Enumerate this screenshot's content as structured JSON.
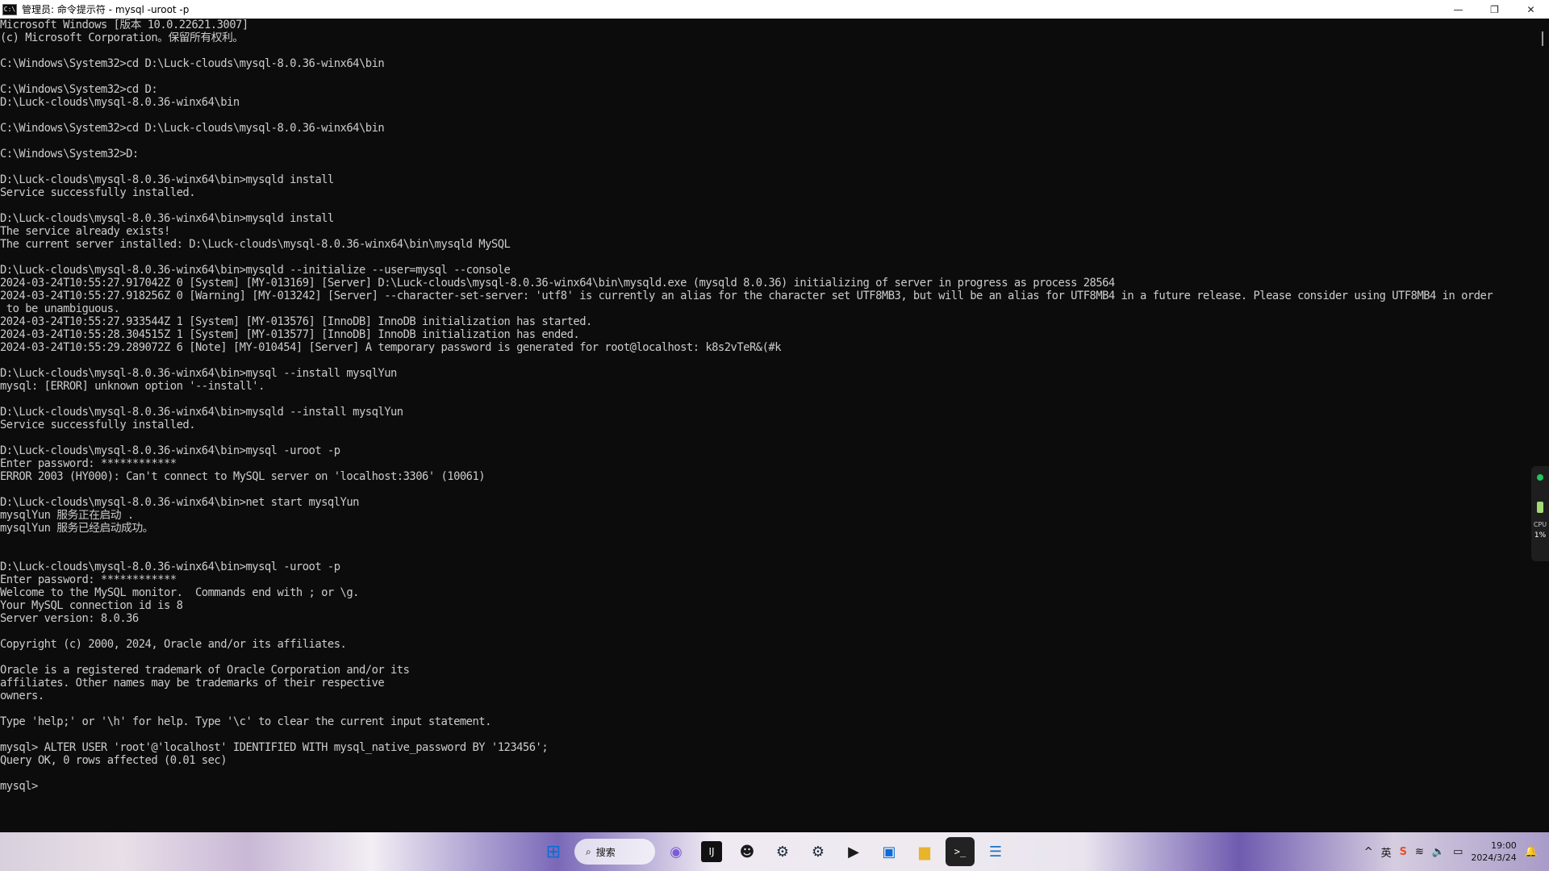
{
  "window": {
    "title": "管理员: 命令提示符 - mysql  -uroot -p",
    "icon_text": "C:\\",
    "controls": [
      "—",
      "❐",
      "✕"
    ]
  },
  "console": {
    "lines": [
      "Microsoft Windows [版本 10.0.22621.3007]",
      "(c) Microsoft Corporation。保留所有权利。",
      "",
      "C:\\Windows\\System32>cd D:\\Luck-clouds\\mysql-8.0.36-winx64\\bin",
      "",
      "C:\\Windows\\System32>cd D:",
      "D:\\Luck-clouds\\mysql-8.0.36-winx64\\bin",
      "",
      "C:\\Windows\\System32>cd D:\\Luck-clouds\\mysql-8.0.36-winx64\\bin",
      "",
      "C:\\Windows\\System32>D:",
      "",
      "D:\\Luck-clouds\\mysql-8.0.36-winx64\\bin>mysqld install",
      "Service successfully installed.",
      "",
      "D:\\Luck-clouds\\mysql-8.0.36-winx64\\bin>mysqld install",
      "The service already exists!",
      "The current server installed: D:\\Luck-clouds\\mysql-8.0.36-winx64\\bin\\mysqld MySQL",
      "",
      "D:\\Luck-clouds\\mysql-8.0.36-winx64\\bin>mysqld --initialize --user=mysql --console",
      "2024-03-24T10:55:27.917042Z 0 [System] [MY-013169] [Server] D:\\Luck-clouds\\mysql-8.0.36-winx64\\bin\\mysqld.exe (mysqld 8.0.36) initializing of server in progress as process 28564",
      "2024-03-24T10:55:27.918256Z 0 [Warning] [MY-013242] [Server] --character-set-server: 'utf8' is currently an alias for the character set UTF8MB3, but will be an alias for UTF8MB4 in a future release. Please consider using UTF8MB4 in order",
      " to be unambiguous.",
      "2024-03-24T10:55:27.933544Z 1 [System] [MY-013576] [InnoDB] InnoDB initialization has started.",
      "2024-03-24T10:55:28.304515Z 1 [System] [MY-013577] [InnoDB] InnoDB initialization has ended.",
      "2024-03-24T10:55:29.289072Z 6 [Note] [MY-010454] [Server] A temporary password is generated for root@localhost: k8s2vTeR&(#k",
      "",
      "D:\\Luck-clouds\\mysql-8.0.36-winx64\\bin>mysql --install mysqlYun",
      "mysql: [ERROR] unknown option '--install'.",
      "",
      "D:\\Luck-clouds\\mysql-8.0.36-winx64\\bin>mysqld --install mysqlYun",
      "Service successfully installed.",
      "",
      "D:\\Luck-clouds\\mysql-8.0.36-winx64\\bin>mysql -uroot -p",
      "Enter password: ************",
      "ERROR 2003 (HY000): Can't connect to MySQL server on 'localhost:3306' (10061)",
      "",
      "D:\\Luck-clouds\\mysql-8.0.36-winx64\\bin>net start mysqlYun",
      "mysqlYun 服务正在启动 .",
      "mysqlYun 服务已经启动成功。",
      "",
      "",
      "D:\\Luck-clouds\\mysql-8.0.36-winx64\\bin>mysql -uroot -p",
      "Enter password: ************",
      "Welcome to the MySQL monitor.  Commands end with ; or \\g.",
      "Your MySQL connection id is 8",
      "Server version: 8.0.36",
      "",
      "Copyright (c) 2000, 2024, Oracle and/or its affiliates.",
      "",
      "Oracle is a registered trademark of Oracle Corporation and/or its",
      "affiliates. Other names may be trademarks of their respective",
      "owners.",
      "",
      "Type 'help;' or '\\h' for help. Type '\\c' to clear the current input statement.",
      "",
      "mysql> ALTER USER 'root'@'localhost' IDENTIFIED WITH mysql_native_password BY '123456';",
      "Query OK, 0 rows affected (0.01 sec)",
      "",
      "mysql>"
    ]
  },
  "side_widget": {
    "label": "CPU",
    "value": "1%"
  },
  "taskbar": {
    "search_label": "搜索",
    "apps": [
      {
        "name": "start",
        "glyph": "⊞"
      },
      {
        "name": "copilot",
        "glyph": "◉"
      },
      {
        "name": "intellij",
        "glyph": "IJ"
      },
      {
        "name": "qq",
        "glyph": "☻"
      },
      {
        "name": "steam",
        "glyph": "⚙"
      },
      {
        "name": "steam-alt",
        "glyph": "⚙"
      },
      {
        "name": "media-player",
        "glyph": "▶"
      },
      {
        "name": "window-app",
        "glyph": "▣"
      },
      {
        "name": "file-explorer",
        "glyph": "▆"
      },
      {
        "name": "terminal",
        "glyph": ">_"
      },
      {
        "name": "notepad",
        "glyph": "☰"
      }
    ],
    "tray": {
      "chevron": "^",
      "ime": "英",
      "sogou": "S",
      "wifi": "≋",
      "volume": "🔈",
      "battery": "▭",
      "time": "19:00",
      "date": "2024/3/24",
      "notification": "🔔"
    }
  }
}
